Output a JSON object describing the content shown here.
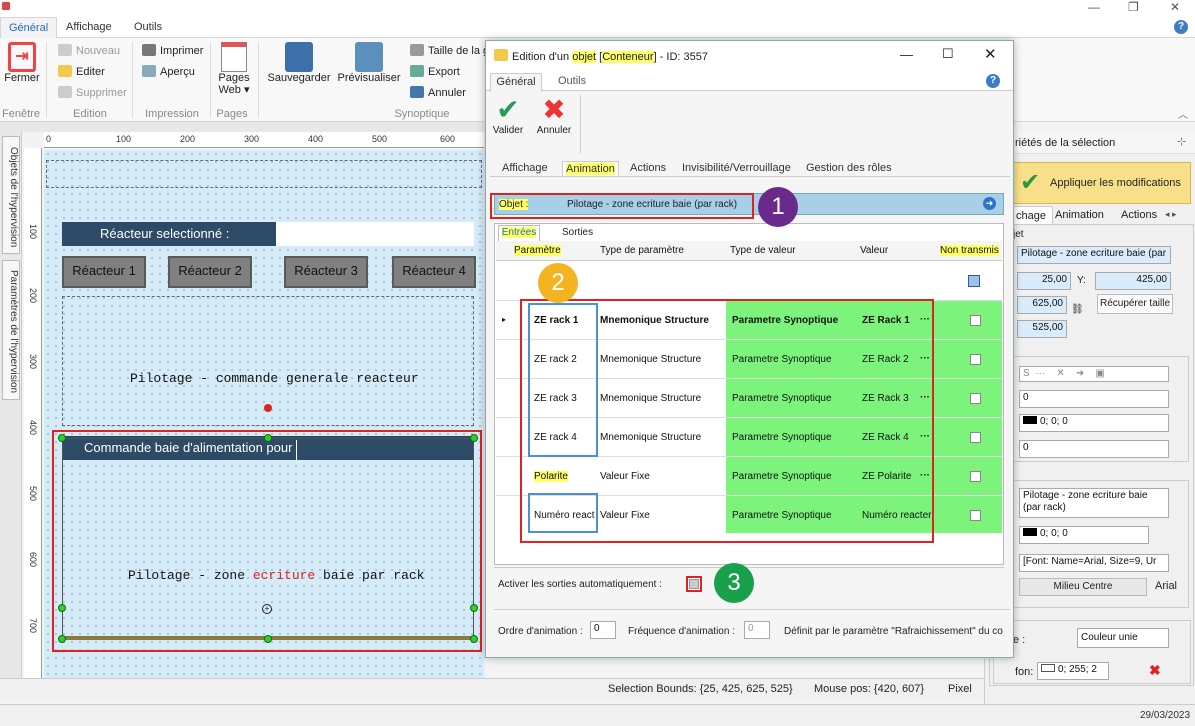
{
  "ribbon": {
    "tabs": [
      "Général",
      "Affichage",
      "Outils"
    ],
    "fermer": "Fermer",
    "nouveau": "Nouveau",
    "editer": "Editer",
    "supprimer": "Supprimer",
    "imprimer": "Imprimer",
    "apercu": "Aperçu",
    "pages_web": "Pages Web ▾",
    "sauvegarder": "Sauvegarder",
    "previsualiser": "Prévisualiser",
    "taille_de_la": "Taille de la g",
    "export": "Export",
    "annuler": "Annuler",
    "groups": {
      "fenetre": "Fenêtre",
      "edition": "Edition",
      "impression": "Impression",
      "pages": "Pages ...",
      "synoptique": "Synoptique"
    }
  },
  "left_tabs": [
    "Objets de l'hypervision",
    "Paramètres de l'hypervision"
  ],
  "rulers": {
    "top": [
      "0",
      "100",
      "200",
      "300",
      "400",
      "500",
      "600"
    ],
    "left": [
      "100",
      "200",
      "300",
      "400",
      "500",
      "600",
      "700"
    ]
  },
  "canvas": {
    "reacteur_selectionne": "Réacteur selectionné :",
    "reacteurs": [
      "Réacteur 1",
      "Réacteur 2",
      "Réacteur 3",
      "Réacteur 4"
    ],
    "pilotage_generale": "Pilotage - commande generale reacteur",
    "commande_baie": "Commande baie d'alimentation pour",
    "pilotage_zone_prefix": "Pilotage - zone ",
    "pilotage_zone_red": "ecriture",
    "pilotage_zone_suffix": " baie par rack"
  },
  "dialog": {
    "title_prefix": "Edition d'un ",
    "title_obj": "objet",
    "title_bracket_open": " [",
    "title_cont": "Conteneur",
    "title_suffix": "] - ID: 3557",
    "tabs": [
      "Général",
      "Outils"
    ],
    "valider": "Valider",
    "annuler": "Annuler",
    "subtabs": [
      "Affichage",
      "Animation",
      "Actions",
      "Invisibilité/Verrouillage",
      "Gestion des rôles"
    ],
    "objet_label": "Objet :",
    "objet_value": "Pilotage - zone ecriture baie (par rack)",
    "entrees": "Entrées",
    "sorties": "Sorties",
    "headers": [
      "Paramètre",
      "Type de paramètre",
      "Type de valeur",
      "Valeur",
      "Non transmis"
    ],
    "rows": [
      {
        "param": "ZE rack 1",
        "type": "Mnemonique Structure",
        "tval": "Parametre Synoptique",
        "val": "ZE Rack 1"
      },
      {
        "param": "ZE rack 2",
        "type": "Mnemonique Structure",
        "tval": "Parametre Synoptique",
        "val": "ZE Rack 2"
      },
      {
        "param": "ZE rack 3",
        "type": "Mnemonique Structure",
        "tval": "Parametre Synoptique",
        "val": "ZE Rack 3"
      },
      {
        "param": "ZE rack 4",
        "type": "Mnemonique Structure",
        "tval": "Parametre Synoptique",
        "val": "ZE Rack 4"
      },
      {
        "param": "Polarite",
        "type": "Valeur Fixe",
        "tval": "Parametre Synoptique",
        "val": "ZE Polarite"
      },
      {
        "param": "Numéro react",
        "type": "Valeur Fixe",
        "tval": "Parametre Synoptique",
        "val": "Numéro reacter"
      }
    ],
    "ellipsis": "···",
    "activer": "Activer les sorties automatiquement :",
    "ordre": "Ordre d'animation :",
    "ordre_val": "0",
    "frequence": "Fréquence d'animation :",
    "freq_val": "0",
    "defini": "Définit par le paramètre \"Rafraichissement\" du co"
  },
  "callouts": [
    "1",
    "2",
    "3"
  ],
  "right_panel": {
    "title": "riétés de la sélection",
    "apply": "Appliquer les modifications",
    "tabs": [
      "chage",
      "Animation",
      "Actions"
    ],
    "jet": "jet",
    "name": "Pilotage - zone ecriture baie (par",
    "x": "25,00",
    "y_label": "Y:",
    "y": "425,00",
    "w": "625,00",
    "h": "525,00",
    "recuperer": "Récupérer taille",
    "zero1": "0",
    "color1": "0; 0; 0",
    "zero2": "0",
    "name2": "Pilotage - zone ecriture baie (par rack)",
    "color2": "0; 0; 0",
    "font": "[Font: Name=Arial, Size=9, Ur",
    "align": "Milieu Centre",
    "arial": "Arial",
    "e_label": "e :",
    "couleur": "Couleur unie",
    "fon_label": "fon:",
    "fon_val": "0; 255; 2"
  },
  "status": {
    "selection": "Selection Bounds: {25, 425, 625, 525}",
    "mouse": "Mouse pos: {420, 607}",
    "pixel": "Pixel",
    "date": "29/03/2023"
  },
  "colors": {
    "green_cells": "#7cf47c",
    "accent": "#1e6fbf",
    "navy": "#2d4a66",
    "red_outline": "#d22222"
  }
}
